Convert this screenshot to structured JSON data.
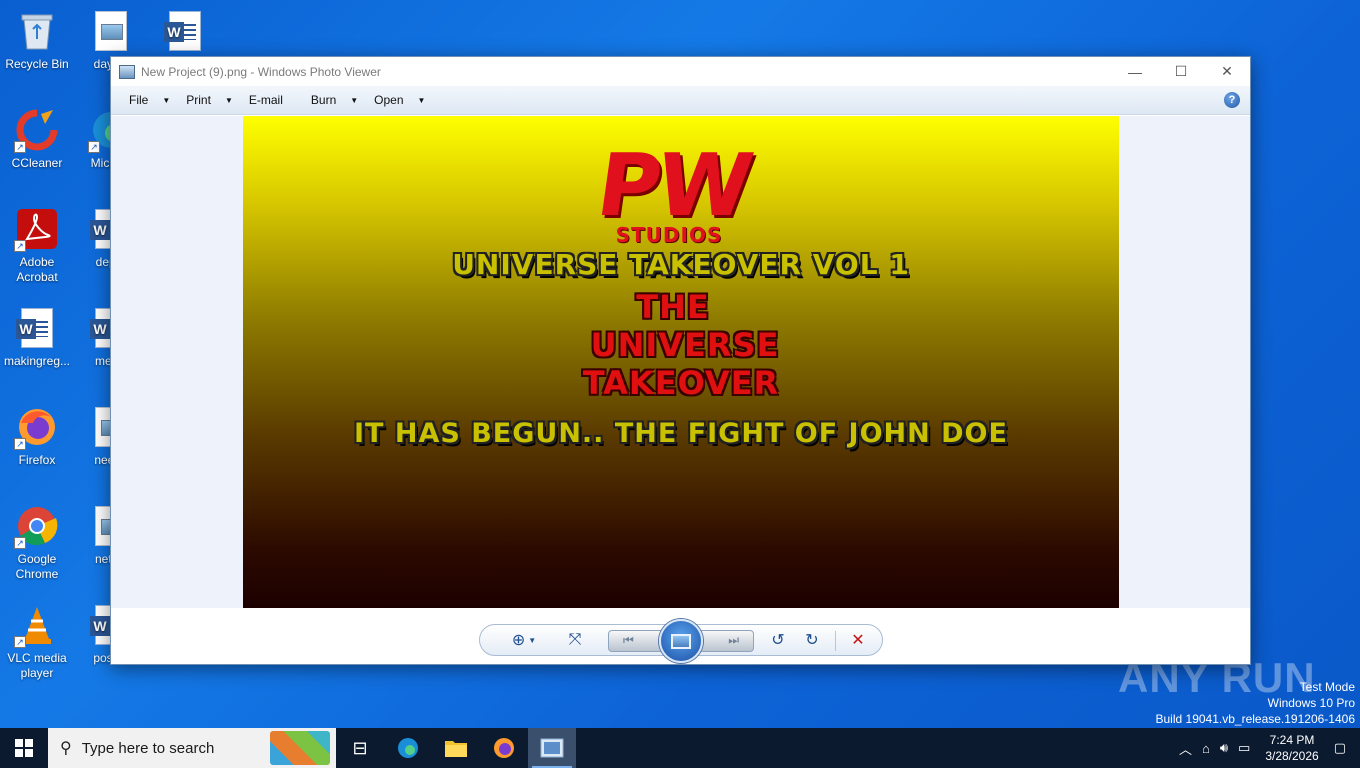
{
  "desktop": {
    "icons": [
      {
        "label": "Recycle Bin"
      },
      {
        "label": "daysdl"
      },
      {
        "label": ""
      },
      {
        "label": "CCleaner"
      },
      {
        "label": "Micr Ed"
      },
      {
        "label": "Adobe Acrobat"
      },
      {
        "label": "depar"
      },
      {
        "label": "makingreg..."
      },
      {
        "label": "medic"
      },
      {
        "label": "Firefox"
      },
      {
        "label": "neede"
      },
      {
        "label": "Google Chrome"
      },
      {
        "label": "netwo"
      },
      {
        "label": "VLC media player"
      },
      {
        "label": "postsa"
      }
    ]
  },
  "window": {
    "title": "New Project (9).png - Windows Photo Viewer",
    "controls": {
      "minimize": "—",
      "maximize": "☐",
      "close": "✕"
    },
    "menu": [
      {
        "label": "File"
      },
      {
        "label": "Print"
      },
      {
        "label": "E-mail"
      },
      {
        "label": "Burn"
      },
      {
        "label": "Open"
      }
    ],
    "help": "?"
  },
  "photo": {
    "logo": "PW",
    "logo_sub": "STUDIOS",
    "line1": "UNIVERSE TAKEOVER VOL 1",
    "line2": "THE",
    "line3": "UNIVERSE",
    "line4": "TAKEOVER",
    "line5": "IT HAS BEGUN.. THE FIGHT OF JOHN DOE"
  },
  "toolbar": {
    "zoom_icon": "⊕",
    "fit_icon": "⤧",
    "prev_icon": "⏮",
    "next_icon": "⏭",
    "rotate_ccw_icon": "↺",
    "rotate_cw_icon": "↻",
    "delete_icon": "✕"
  },
  "watermark": {
    "text": "ANY RUN",
    "test_mode": "Test Mode",
    "os": "Windows 10 Pro",
    "build": "Build 19041.vb_release.191206-1406"
  },
  "taskbar": {
    "search_placeholder": "Type here to search",
    "time": "7:24 PM",
    "date": "3/28/2026"
  },
  "colors": {
    "desktop_blue": "#0a5fd0",
    "taskbar": "#0b1a2e",
    "logo_red": "#e0101c",
    "title_yellow": "#c9c000"
  }
}
